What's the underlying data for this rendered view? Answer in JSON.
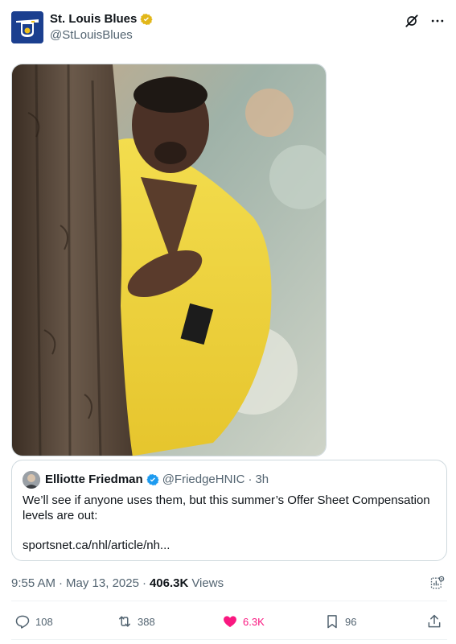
{
  "author": {
    "display_name": "St. Louis Blues",
    "handle": "@StLouisBlues",
    "verified_color": "#e2b719"
  },
  "icons": {
    "header": [
      "grok-icon",
      "more-icon"
    ],
    "actions": [
      "reply-icon",
      "retweet-icon",
      "like-icon",
      "bookmark-icon",
      "share-icon"
    ]
  },
  "quote": {
    "display_name": "Elliotte Friedman",
    "handle": "@FriedgeHNIC",
    "separator": "·",
    "time": "3h",
    "text": "We’ll see if anyone uses them, but this summer’s Offer Sheet Compensation levels are out:",
    "link": "sportsnet.ca/nhl/article/nh..."
  },
  "meta": {
    "time": "9:55 AM",
    "sep1": "·",
    "date": "May 13, 2025",
    "sep2": "·",
    "views_count": "406.3K",
    "views_label": "Views"
  },
  "actions": {
    "replies": "108",
    "reposts": "388",
    "likes": "6.3K",
    "bookmarks": "96"
  },
  "colors": {
    "like_active": "#f91880",
    "muted": "#536471",
    "verified_blue": "#1d9bf0"
  }
}
